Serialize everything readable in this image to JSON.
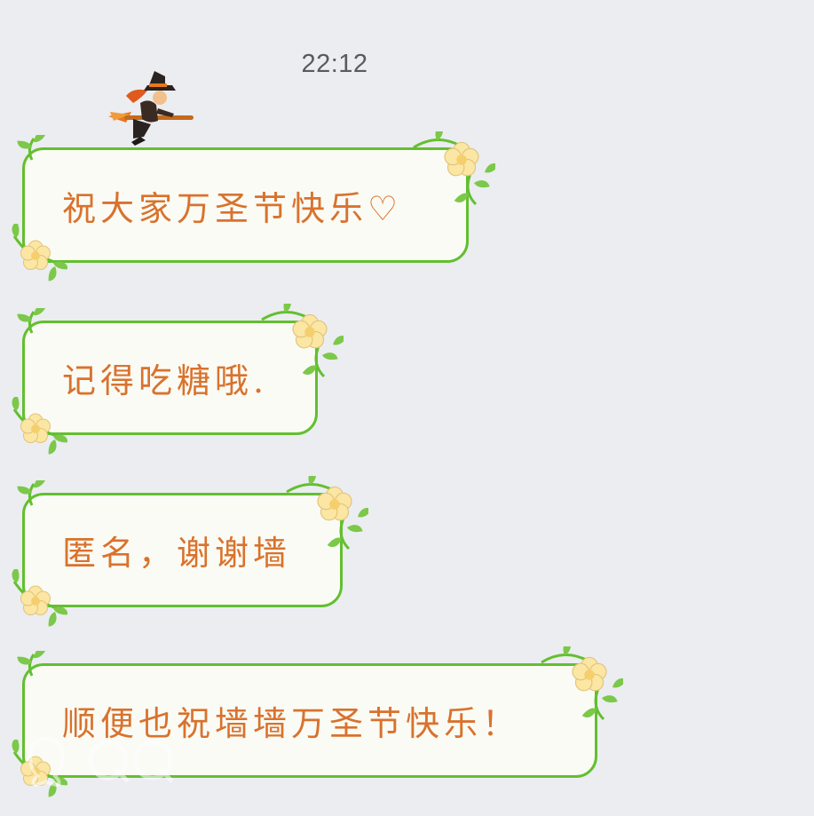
{
  "chat": {
    "timestamp": "22:12",
    "messages": [
      {
        "text": "祝大家万圣节快乐♡"
      },
      {
        "text": "记得吃糖哦."
      },
      {
        "text": "匿名，谢谢墙"
      },
      {
        "text": "顺便也祝墙墙万圣节快乐！"
      }
    ]
  },
  "theme": {
    "background": "#ebedf1",
    "bubble_fill": "#fafbf4",
    "bubble_border": "#63bf2f",
    "text_color": "#d9722d",
    "flower_color": "#fbe6a3"
  },
  "icons": {
    "sticker": "witch-on-broom-icon",
    "bubble_decoration": "vine-flower-icon",
    "watermark": "qq-logo-watermark"
  }
}
